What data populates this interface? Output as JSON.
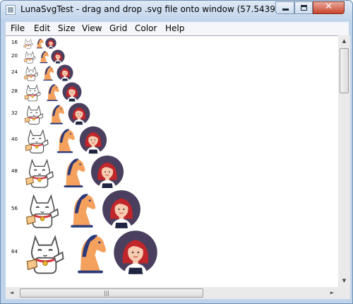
{
  "window": {
    "title": "LunaSvgTest - drag and drop .svg file onto window (57.543944ms,...",
    "close_glyph": "✕"
  },
  "menu": [
    {
      "label": "File",
      "key": "file"
    },
    {
      "label": "Edit",
      "key": "edit"
    },
    {
      "label": "Size",
      "key": "size"
    },
    {
      "label": "View",
      "key": "view"
    },
    {
      "label": "Grid",
      "key": "grid"
    },
    {
      "label": "Color",
      "key": "color"
    },
    {
      "label": "Help",
      "key": "help"
    }
  ],
  "size_labels": [
    "16",
    "20",
    "24",
    "28",
    "32",
    "40",
    "48",
    "56",
    "64"
  ],
  "colors": {
    "accent": "#c3d6ec",
    "close_button": "#c8442b",
    "horse_body": "#f5a15e",
    "horse_mane": "#2c3a7a",
    "girl_background": "#4a3f5e",
    "girl_hair": "#c0262a"
  },
  "icons": [
    "lucky-cat-icon",
    "horse-icon",
    "girl-avatar-icon"
  ],
  "scroll": {
    "up": "▲",
    "down": "▼",
    "left": "◄",
    "right": "►",
    "grip": "|||"
  }
}
